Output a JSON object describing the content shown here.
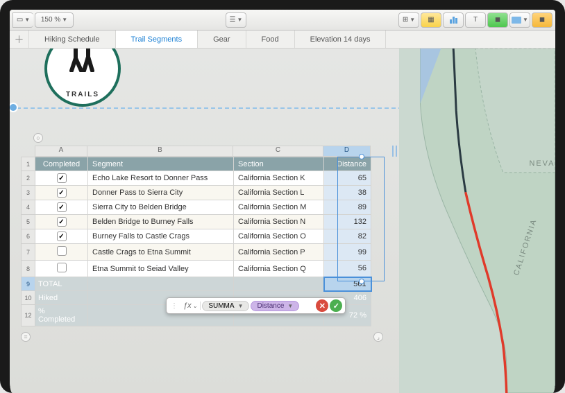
{
  "toolbar": {
    "zoom": "150 %"
  },
  "tabs": [
    "Hiking Schedule",
    "Trail Segments",
    "Gear",
    "Food",
    "Elevation 14 days"
  ],
  "active_tab": 1,
  "logo_text": "TRAILS",
  "columns": [
    "A",
    "B",
    "C",
    "D"
  ],
  "headers": {
    "a": "Completed",
    "b": "Segment",
    "c": "Section",
    "d": "Distance"
  },
  "rows": [
    {
      "n": 2,
      "done": true,
      "seg": "Echo Lake Resort to Donner Pass",
      "sec": "California Section K",
      "dist": 65
    },
    {
      "n": 3,
      "done": true,
      "seg": "Donner Pass to Sierra City",
      "sec": "California Section L",
      "dist": 38
    },
    {
      "n": 4,
      "done": true,
      "seg": "Sierra City to Belden Bridge",
      "sec": "California Section M",
      "dist": 89
    },
    {
      "n": 5,
      "done": true,
      "seg": "Belden Bridge to Burney Falls",
      "sec": "California Section N",
      "dist": 132
    },
    {
      "n": 6,
      "done": true,
      "seg": "Burney Falls to Castle Crags",
      "sec": "California Section O",
      "dist": 82
    },
    {
      "n": 7,
      "done": false,
      "seg": "Castle Crags to Etna Summit",
      "sec": "California Section P",
      "dist": 99
    },
    {
      "n": 8,
      "done": false,
      "seg": "Etna Summit to Seiad Valley",
      "sec": "California Section Q",
      "dist": 56
    }
  ],
  "summary": {
    "total_n": 9,
    "total_label": "TOTAL",
    "total_val": 561,
    "hiked_n": 10,
    "hiked_label": "Hiked",
    "hiked_val": 406,
    "pct_n": 12,
    "pct_label": "% Completed",
    "pct_val": "72 %"
  },
  "formula": {
    "func": "SUMMA",
    "arg": "Distance"
  },
  "map_labels": {
    "ca": "CALIFORNIA",
    "nv": "NEVAD"
  }
}
